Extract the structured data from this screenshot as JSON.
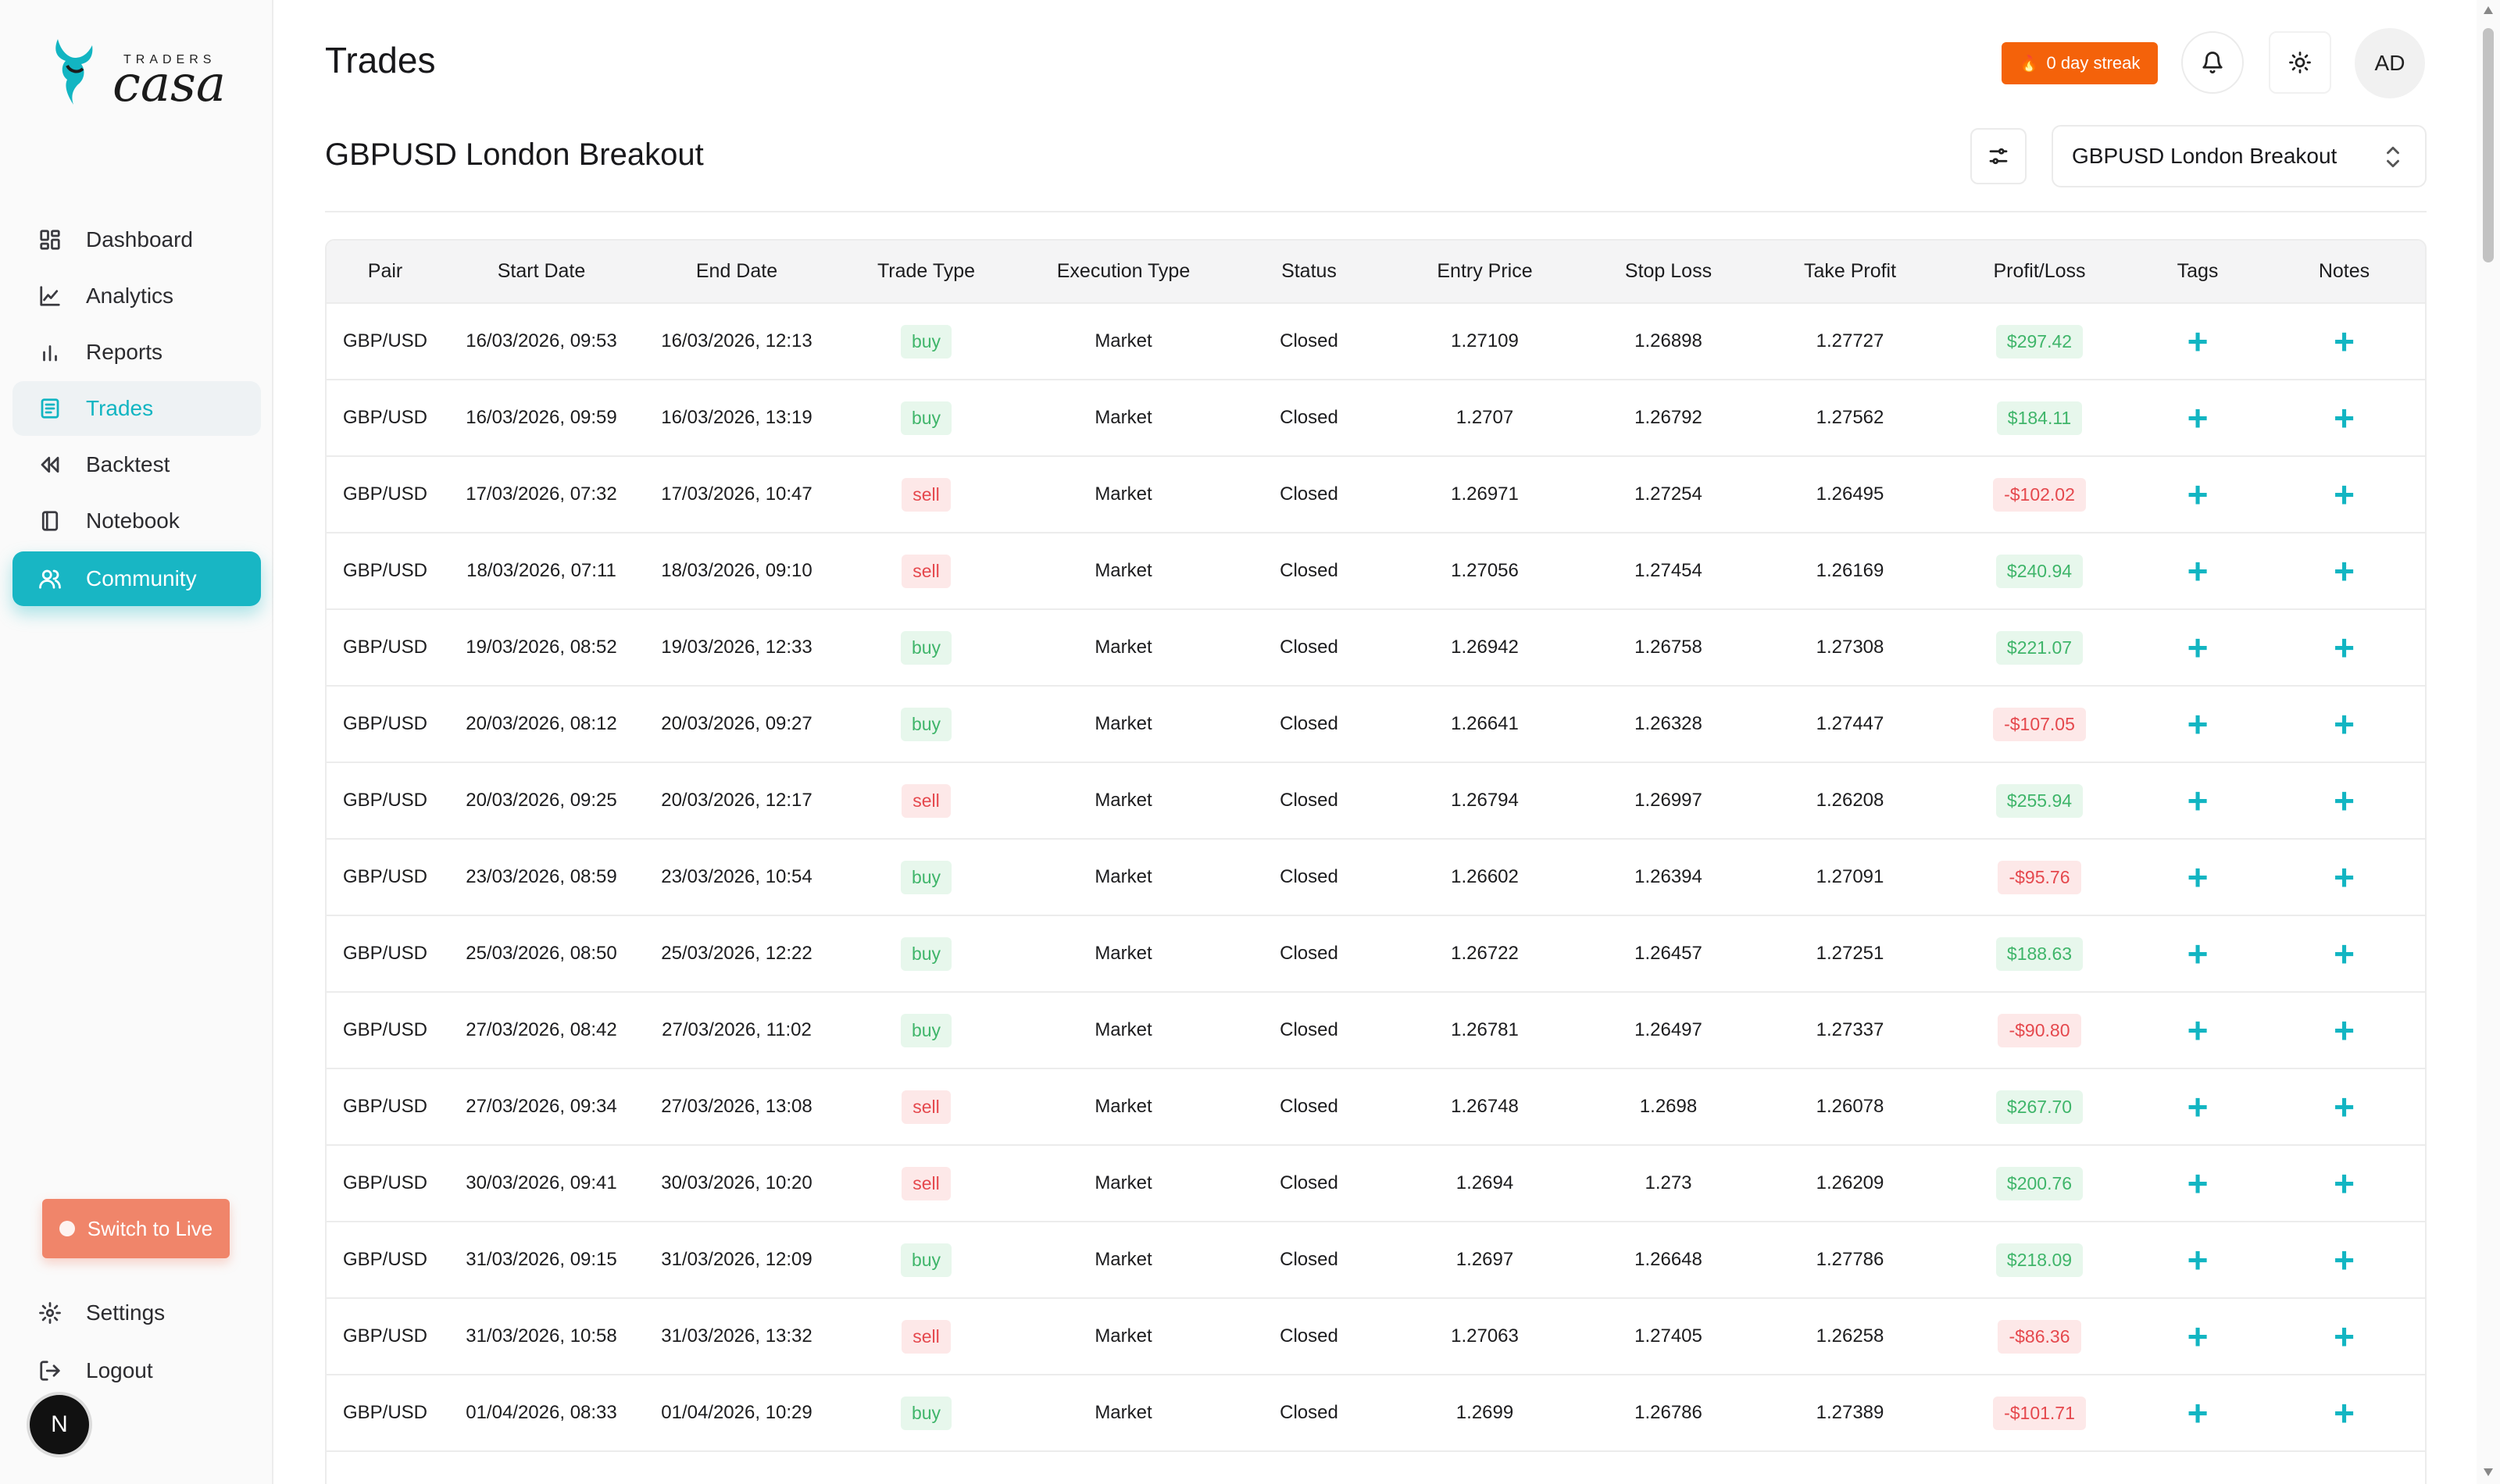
{
  "app": {
    "logo_top": "TRADERS",
    "logo_name": "casa"
  },
  "sidebar": {
    "items": [
      {
        "label": "Dashboard",
        "icon": "dashboard-icon"
      },
      {
        "label": "Analytics",
        "icon": "analytics-icon"
      },
      {
        "label": "Reports",
        "icon": "reports-icon"
      },
      {
        "label": "Trades",
        "icon": "trades-icon"
      },
      {
        "label": "Backtest",
        "icon": "backtest-icon"
      },
      {
        "label": "Notebook",
        "icon": "notebook-icon"
      },
      {
        "label": "Community",
        "icon": "community-icon"
      }
    ],
    "switch_live": "Switch to Live",
    "settings": "Settings",
    "logout": "Logout",
    "avatar_initial": "N"
  },
  "header": {
    "title": "Trades",
    "streak": "0 day streak",
    "user_initials": "AD"
  },
  "strategy": {
    "title": "GBPUSD London Breakout",
    "selected": "GBPUSD London Breakout"
  },
  "colors": {
    "accent": "#18b6c4",
    "streak": "#f4620a",
    "profit": "#3fb56a",
    "loss": "#e5484d",
    "switch_live": "#f0856a"
  },
  "table": {
    "columns": [
      "Pair",
      "Start Date",
      "End Date",
      "Trade Type",
      "Execution Type",
      "Status",
      "Entry Price",
      "Stop Loss",
      "Take Profit",
      "Profit/Loss",
      "Tags",
      "Notes"
    ],
    "rows": [
      {
        "pair": "GBP/USD",
        "start": "16/03/2026, 09:53",
        "end": "16/03/2026, 12:13",
        "type": "buy",
        "exec": "Market",
        "status": "Closed",
        "entry": "1.27109",
        "sl": "1.26898",
        "tp": "1.27727",
        "pl": "$297.42",
        "pl_sign": "profit"
      },
      {
        "pair": "GBP/USD",
        "start": "16/03/2026, 09:59",
        "end": "16/03/2026, 13:19",
        "type": "buy",
        "exec": "Market",
        "status": "Closed",
        "entry": "1.2707",
        "sl": "1.26792",
        "tp": "1.27562",
        "pl": "$184.11",
        "pl_sign": "profit"
      },
      {
        "pair": "GBP/USD",
        "start": "17/03/2026, 07:32",
        "end": "17/03/2026, 10:47",
        "type": "sell",
        "exec": "Market",
        "status": "Closed",
        "entry": "1.26971",
        "sl": "1.27254",
        "tp": "1.26495",
        "pl": "-$102.02",
        "pl_sign": "loss"
      },
      {
        "pair": "GBP/USD",
        "start": "18/03/2026, 07:11",
        "end": "18/03/2026, 09:10",
        "type": "sell",
        "exec": "Market",
        "status": "Closed",
        "entry": "1.27056",
        "sl": "1.27454",
        "tp": "1.26169",
        "pl": "$240.94",
        "pl_sign": "profit"
      },
      {
        "pair": "GBP/USD",
        "start": "19/03/2026, 08:52",
        "end": "19/03/2026, 12:33",
        "type": "buy",
        "exec": "Market",
        "status": "Closed",
        "entry": "1.26942",
        "sl": "1.26758",
        "tp": "1.27308",
        "pl": "$221.07",
        "pl_sign": "profit"
      },
      {
        "pair": "GBP/USD",
        "start": "20/03/2026, 08:12",
        "end": "20/03/2026, 09:27",
        "type": "buy",
        "exec": "Market",
        "status": "Closed",
        "entry": "1.26641",
        "sl": "1.26328",
        "tp": "1.27447",
        "pl": "-$107.05",
        "pl_sign": "loss"
      },
      {
        "pair": "GBP/USD",
        "start": "20/03/2026, 09:25",
        "end": "20/03/2026, 12:17",
        "type": "sell",
        "exec": "Market",
        "status": "Closed",
        "entry": "1.26794",
        "sl": "1.26997",
        "tp": "1.26208",
        "pl": "$255.94",
        "pl_sign": "profit"
      },
      {
        "pair": "GBP/USD",
        "start": "23/03/2026, 08:59",
        "end": "23/03/2026, 10:54",
        "type": "buy",
        "exec": "Market",
        "status": "Closed",
        "entry": "1.26602",
        "sl": "1.26394",
        "tp": "1.27091",
        "pl": "-$95.76",
        "pl_sign": "loss"
      },
      {
        "pair": "GBP/USD",
        "start": "25/03/2026, 08:50",
        "end": "25/03/2026, 12:22",
        "type": "buy",
        "exec": "Market",
        "status": "Closed",
        "entry": "1.26722",
        "sl": "1.26457",
        "tp": "1.27251",
        "pl": "$188.63",
        "pl_sign": "profit"
      },
      {
        "pair": "GBP/USD",
        "start": "27/03/2026, 08:42",
        "end": "27/03/2026, 11:02",
        "type": "buy",
        "exec": "Market",
        "status": "Closed",
        "entry": "1.26781",
        "sl": "1.26497",
        "tp": "1.27337",
        "pl": "-$90.80",
        "pl_sign": "loss"
      },
      {
        "pair": "GBP/USD",
        "start": "27/03/2026, 09:34",
        "end": "27/03/2026, 13:08",
        "type": "sell",
        "exec": "Market",
        "status": "Closed",
        "entry": "1.26748",
        "sl": "1.2698",
        "tp": "1.26078",
        "pl": "$267.70",
        "pl_sign": "profit"
      },
      {
        "pair": "GBP/USD",
        "start": "30/03/2026, 09:41",
        "end": "30/03/2026, 10:20",
        "type": "sell",
        "exec": "Market",
        "status": "Closed",
        "entry": "1.2694",
        "sl": "1.273",
        "tp": "1.26209",
        "pl": "$200.76",
        "pl_sign": "profit"
      },
      {
        "pair": "GBP/USD",
        "start": "31/03/2026, 09:15",
        "end": "31/03/2026, 12:09",
        "type": "buy",
        "exec": "Market",
        "status": "Closed",
        "entry": "1.2697",
        "sl": "1.26648",
        "tp": "1.27786",
        "pl": "$218.09",
        "pl_sign": "profit"
      },
      {
        "pair": "GBP/USD",
        "start": "31/03/2026, 10:58",
        "end": "31/03/2026, 13:32",
        "type": "sell",
        "exec": "Market",
        "status": "Closed",
        "entry": "1.27063",
        "sl": "1.27405",
        "tp": "1.26258",
        "pl": "-$86.36",
        "pl_sign": "loss"
      },
      {
        "pair": "GBP/USD",
        "start": "01/04/2026, 08:33",
        "end": "01/04/2026, 10:29",
        "type": "buy",
        "exec": "Market",
        "status": "Closed",
        "entry": "1.2699",
        "sl": "1.26786",
        "tp": "1.27389",
        "pl": "-$101.71",
        "pl_sign": "loss"
      }
    ]
  }
}
